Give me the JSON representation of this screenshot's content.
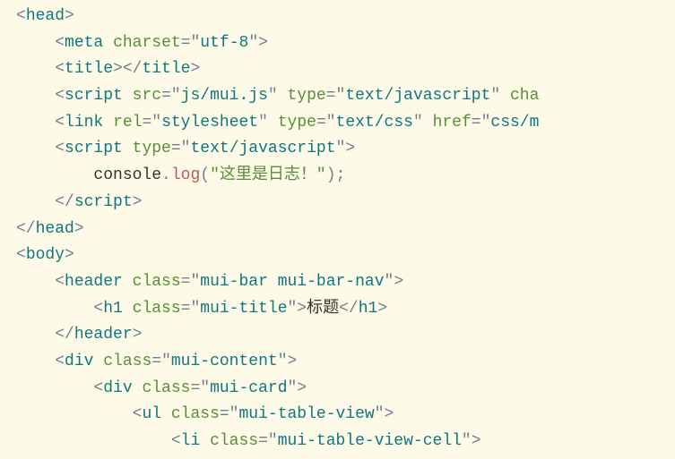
{
  "code": {
    "lines": [
      {
        "indent": 0,
        "segments": [
          {
            "t": "<",
            "c": "punct"
          },
          {
            "t": "head",
            "c": "tag-name"
          },
          {
            "t": ">",
            "c": "punct"
          }
        ]
      },
      {
        "indent": 1,
        "segments": [
          {
            "t": "<",
            "c": "punct"
          },
          {
            "t": "meta",
            "c": "tag-name"
          },
          {
            "t": " ",
            "c": "punct"
          },
          {
            "t": "charset",
            "c": "attr-name"
          },
          {
            "t": "=\"",
            "c": "punct"
          },
          {
            "t": "utf-8",
            "c": "attr-value"
          },
          {
            "t": "\">",
            "c": "punct"
          }
        ]
      },
      {
        "indent": 1,
        "segments": [
          {
            "t": "<",
            "c": "punct"
          },
          {
            "t": "title",
            "c": "tag-name"
          },
          {
            "t": "></",
            "c": "punct"
          },
          {
            "t": "title",
            "c": "tag-name"
          },
          {
            "t": ">",
            "c": "punct"
          }
        ]
      },
      {
        "indent": 1,
        "segments": [
          {
            "t": "<",
            "c": "punct"
          },
          {
            "t": "script",
            "c": "tag-name"
          },
          {
            "t": " ",
            "c": "punct"
          },
          {
            "t": "src",
            "c": "attr-name"
          },
          {
            "t": "=\"",
            "c": "punct"
          },
          {
            "t": "js/mui.js",
            "c": "attr-value"
          },
          {
            "t": "\" ",
            "c": "punct"
          },
          {
            "t": "type",
            "c": "attr-name"
          },
          {
            "t": "=\"",
            "c": "punct"
          },
          {
            "t": "text/javascript",
            "c": "attr-value"
          },
          {
            "t": "\" ",
            "c": "punct"
          },
          {
            "t": "cha",
            "c": "attr-name"
          }
        ]
      },
      {
        "indent": 1,
        "segments": [
          {
            "t": "<",
            "c": "punct"
          },
          {
            "t": "link",
            "c": "tag-name"
          },
          {
            "t": " ",
            "c": "punct"
          },
          {
            "t": "rel",
            "c": "attr-name"
          },
          {
            "t": "=\"",
            "c": "punct"
          },
          {
            "t": "stylesheet",
            "c": "attr-value"
          },
          {
            "t": "\" ",
            "c": "punct"
          },
          {
            "t": "type",
            "c": "attr-name"
          },
          {
            "t": "=\"",
            "c": "punct"
          },
          {
            "t": "text/css",
            "c": "attr-value"
          },
          {
            "t": "\" ",
            "c": "punct"
          },
          {
            "t": "href",
            "c": "attr-name"
          },
          {
            "t": "=\"",
            "c": "punct"
          },
          {
            "t": "css/m",
            "c": "attr-value"
          }
        ]
      },
      {
        "indent": 1,
        "segments": [
          {
            "t": "<",
            "c": "punct"
          },
          {
            "t": "script",
            "c": "tag-name"
          },
          {
            "t": " ",
            "c": "punct"
          },
          {
            "t": "type",
            "c": "attr-name"
          },
          {
            "t": "=\"",
            "c": "punct"
          },
          {
            "t": "text/javascript",
            "c": "attr-value"
          },
          {
            "t": "\">",
            "c": "punct"
          }
        ]
      },
      {
        "indent": 2,
        "segments": [
          {
            "t": "console",
            "c": "text-content"
          },
          {
            "t": ".",
            "c": "punct"
          },
          {
            "t": "log",
            "c": "method"
          },
          {
            "t": "(",
            "c": "punct"
          },
          {
            "t": "\"这里是日志！\"",
            "c": "string-literal"
          },
          {
            "t": ")",
            "c": "punct"
          },
          {
            "t": ";",
            "c": "punct"
          }
        ]
      },
      {
        "indent": 1,
        "segments": [
          {
            "t": "</",
            "c": "punct"
          },
          {
            "t": "script",
            "c": "tag-name"
          },
          {
            "t": ">",
            "c": "punct"
          }
        ]
      },
      {
        "indent": 0,
        "segments": [
          {
            "t": "</",
            "c": "punct"
          },
          {
            "t": "head",
            "c": "tag-name"
          },
          {
            "t": ">",
            "c": "punct"
          }
        ]
      },
      {
        "indent": 0,
        "segments": [
          {
            "t": "<",
            "c": "punct"
          },
          {
            "t": "body",
            "c": "tag-name"
          },
          {
            "t": ">",
            "c": "punct"
          }
        ]
      },
      {
        "indent": 1,
        "segments": [
          {
            "t": "<",
            "c": "punct"
          },
          {
            "t": "header",
            "c": "tag-name"
          },
          {
            "t": " ",
            "c": "punct"
          },
          {
            "t": "class",
            "c": "attr-name"
          },
          {
            "t": "=\"",
            "c": "punct"
          },
          {
            "t": "mui-bar mui-bar-nav",
            "c": "attr-value"
          },
          {
            "t": "\">",
            "c": "punct"
          }
        ]
      },
      {
        "indent": 2,
        "segments": [
          {
            "t": "<",
            "c": "punct"
          },
          {
            "t": "h1",
            "c": "tag-name"
          },
          {
            "t": " ",
            "c": "punct"
          },
          {
            "t": "class",
            "c": "attr-name"
          },
          {
            "t": "=\"",
            "c": "punct"
          },
          {
            "t": "mui-title",
            "c": "attr-value"
          },
          {
            "t": "\">",
            "c": "punct"
          },
          {
            "t": "标题",
            "c": "text-content"
          },
          {
            "t": "</",
            "c": "punct"
          },
          {
            "t": "h1",
            "c": "tag-name"
          },
          {
            "t": ">",
            "c": "punct"
          }
        ]
      },
      {
        "indent": 1,
        "segments": [
          {
            "t": "</",
            "c": "punct"
          },
          {
            "t": "header",
            "c": "tag-name"
          },
          {
            "t": ">",
            "c": "punct"
          }
        ]
      },
      {
        "indent": 1,
        "segments": [
          {
            "t": "<",
            "c": "punct"
          },
          {
            "t": "div",
            "c": "tag-name"
          },
          {
            "t": " ",
            "c": "punct"
          },
          {
            "t": "class",
            "c": "attr-name"
          },
          {
            "t": "=\"",
            "c": "punct"
          },
          {
            "t": "mui-content",
            "c": "attr-value"
          },
          {
            "t": "\">",
            "c": "punct"
          }
        ]
      },
      {
        "indent": 2,
        "segments": [
          {
            "t": "<",
            "c": "punct"
          },
          {
            "t": "div",
            "c": "tag-name"
          },
          {
            "t": " ",
            "c": "punct"
          },
          {
            "t": "class",
            "c": "attr-name"
          },
          {
            "t": "=\"",
            "c": "punct"
          },
          {
            "t": "mui-card",
            "c": "attr-value"
          },
          {
            "t": "\">",
            "c": "punct"
          }
        ]
      },
      {
        "indent": 3,
        "segments": [
          {
            "t": "<",
            "c": "punct"
          },
          {
            "t": "ul",
            "c": "tag-name"
          },
          {
            "t": " ",
            "c": "punct"
          },
          {
            "t": "class",
            "c": "attr-name"
          },
          {
            "t": "=\"",
            "c": "punct"
          },
          {
            "t": "mui-table-view",
            "c": "attr-value"
          },
          {
            "t": "\">",
            "c": "punct"
          }
        ]
      },
      {
        "indent": 4,
        "segments": [
          {
            "t": "<",
            "c": "punct"
          },
          {
            "t": "li",
            "c": "tag-name"
          },
          {
            "t": " ",
            "c": "punct"
          },
          {
            "t": "class",
            "c": "attr-name"
          },
          {
            "t": "=\"",
            "c": "punct"
          },
          {
            "t": "mui-table-view-cell",
            "c": "attr-value"
          },
          {
            "t": "\">",
            "c": "punct"
          }
        ]
      }
    ],
    "indentUnit": "    "
  }
}
